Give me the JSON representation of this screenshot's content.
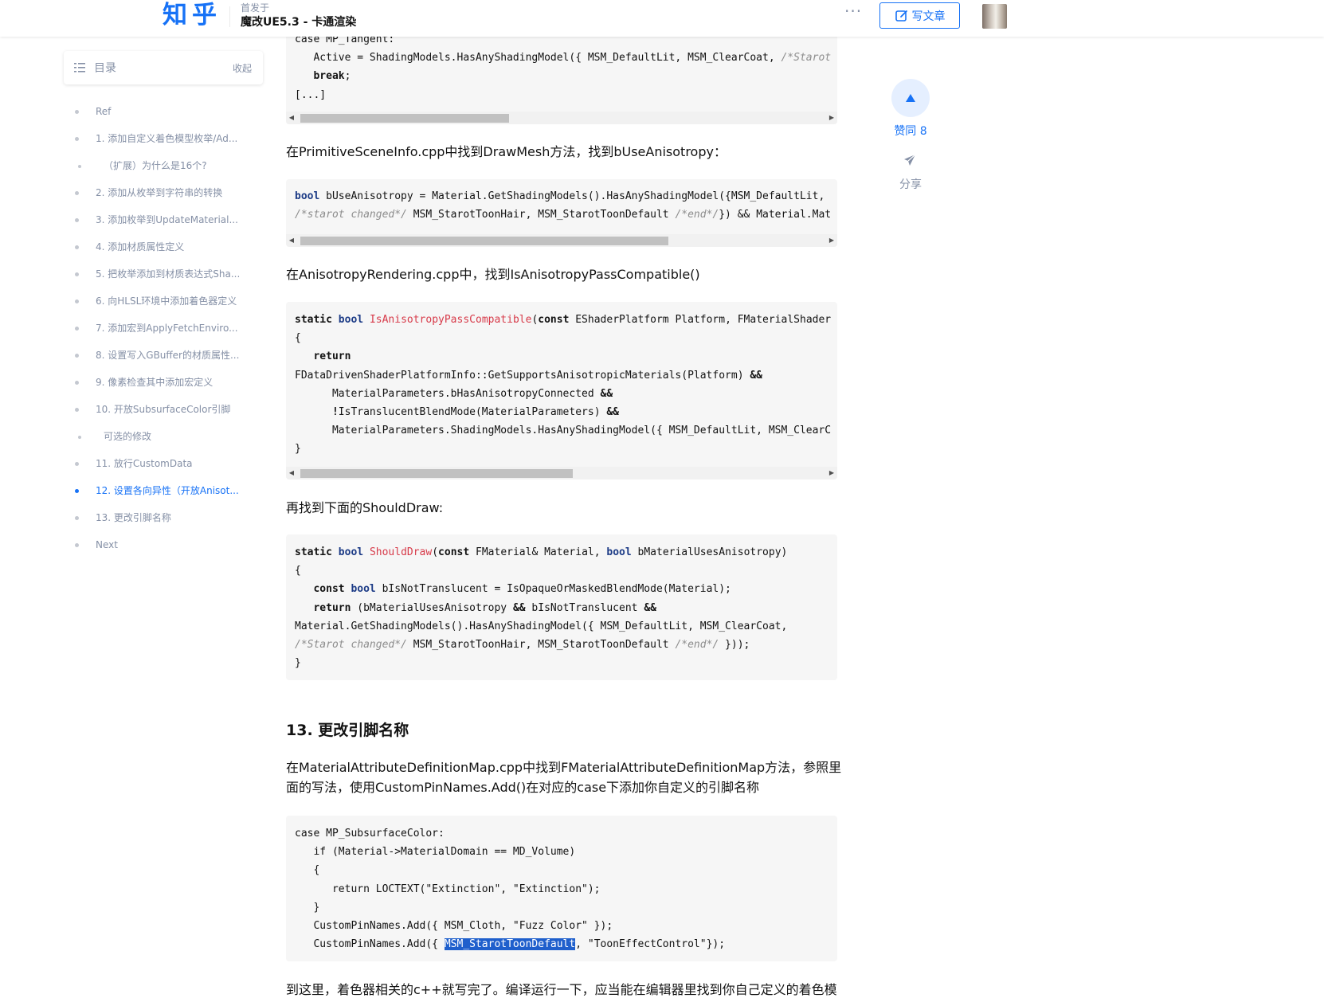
{
  "header": {
    "logo": "知乎",
    "sub": "首发于",
    "title": "魔改UE5.3 - 卡通渲染",
    "more": "···",
    "write_label": "写文章"
  },
  "toc": {
    "title": "目录",
    "collapse": "收起",
    "items": [
      {
        "label": "Ref",
        "sub": false,
        "active": false
      },
      {
        "label": "1. 添加自定义着色模型枚举/Ad...",
        "sub": false,
        "active": false
      },
      {
        "label": "（扩展）为什么是16个?",
        "sub": true,
        "active": false
      },
      {
        "label": "2. 添加从枚举到字符串的转换",
        "sub": false,
        "active": false
      },
      {
        "label": "3. 添加枚举到UpdateMaterial...",
        "sub": false,
        "active": false
      },
      {
        "label": "4. 添加材质属性定义",
        "sub": false,
        "active": false
      },
      {
        "label": "5. 把枚举添加到材质表达式Sha...",
        "sub": false,
        "active": false
      },
      {
        "label": "6. 向HLSL环境中添加着色器定义",
        "sub": false,
        "active": false
      },
      {
        "label": "7. 添加宏到ApplyFetchEnviro...",
        "sub": false,
        "active": false
      },
      {
        "label": "8. 设置写入GBuffer的材质属性...",
        "sub": false,
        "active": false
      },
      {
        "label": "9. 像素检查其中添加宏定义",
        "sub": false,
        "active": false
      },
      {
        "label": "10. 开放SubsurfaceColor引脚",
        "sub": false,
        "active": false
      },
      {
        "label": "可选的修改",
        "sub": true,
        "active": false
      },
      {
        "label": "11. 放行CustomData",
        "sub": false,
        "active": false
      },
      {
        "label": "12. 设置各向异性（开放Anisot...",
        "sub": false,
        "active": true
      },
      {
        "label": "13. 更改引脚名称",
        "sub": false,
        "active": false
      },
      {
        "label": "Next",
        "sub": false,
        "active": false
      }
    ]
  },
  "actions": {
    "vote_label": "赞同 8",
    "share_label": "分享"
  },
  "article": {
    "p1": "在PrimitiveSceneInfo.cpp中找到DrawMesh方法，找到bUseAnisotropy：",
    "p2": "在AnisotropyRendering.cpp中，找到IsAnisotropyPassCompatible()",
    "p3": "再找到下面的ShouldDraw:",
    "heading13": "13. 更改引脚名称",
    "p4": "在MaterialAttributeDefinitionMap.cpp中找到FMaterialAttributeDefinitionMap方法，参照里面的写法，使用CustomPinNames.Add()在对应的case下添加你自定义的引脚名称",
    "p5": "到这里，着色器相关的c++就写完了。编译运行一下，应当能在编辑器里找到你自己定义的着色模"
  },
  "code_blocks": {
    "block1": [
      "case MP_Tangent:",
      "   Active = ShadingModels.HasAnyShadingModel({ MSM_DefaultLit, MSM_ClearCoat, /*Starot",
      "   break;",
      "[...]"
    ],
    "block2": [
      "bool bUseAnisotropy = Material.GetShadingModels().HasAnyShadingModel({MSM_DefaultLit,",
      "/*starot changed*/ MSM_StarotToonHair, MSM_StarotToonDefault /*end*/}) && Material.Mat"
    ],
    "block3": [
      "static bool IsAnisotropyPassCompatible(const EShaderPlatform Platform, FMaterialShader",
      "{",
      "   return",
      "FDataDrivenShaderPlatformInfo::GetSupportsAnisotropicMaterials(Platform) &&",
      "      MaterialParameters.bHasAnisotropyConnected &&",
      "      !IsTranslucentBlendMode(MaterialParameters) &&",
      "      MaterialParameters.ShadingModels.HasAnyShadingModel({ MSM_DefaultLit, MSM_ClearC",
      "}"
    ],
    "block4": [
      "static bool ShouldDraw(const FMaterial& Material, bool bMaterialUsesAnisotropy)",
      "{",
      "   const bool bIsNotTranslucent = IsOpaqueOrMaskedBlendMode(Material);",
      "   return (bMaterialUsesAnisotropy && bIsNotTranslucent &&",
      "Material.GetShadingModels().HasAnyShadingModel({ MSM_DefaultLit, MSM_ClearCoat,",
      "/*Starot changed*/ MSM_StarotToonHair, MSM_StarotToonDefault /*end*/ }));",
      "}"
    ],
    "block5": [
      "case MP_SubsurfaceColor:",
      "   if (Material->MaterialDomain == MD_Volume)",
      "   {",
      "      return LOCTEXT(\"Extinction\", \"Extinction\");",
      "   }",
      "   CustomPinNames.Add({ MSM_Cloth, \"Fuzz Color\" });",
      "   CustomPinNames.Add({ MSM_StarotToonDefault, \"ToonEffectControl\"});"
    ]
  },
  "colors": {
    "brand": "#1772f6",
    "muted": "#8590a6",
    "code_bg": "#f6f6f6",
    "keyword_fn": "#d73a49",
    "type": "#1c3b86",
    "selection": "#1f5fcc"
  },
  "icons": {
    "toc": "toc-list-icon",
    "write": "edit-icon",
    "vote": "triangle-up-icon",
    "share": "paper-plane-icon"
  }
}
